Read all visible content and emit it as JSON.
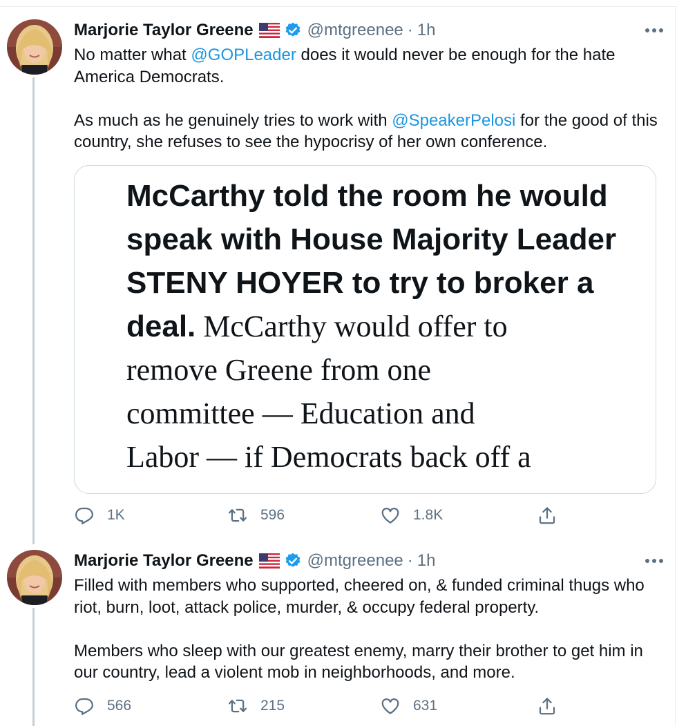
{
  "tweets": [
    {
      "author": {
        "name": "Marjorie Taylor Greene",
        "flag_icon": "us-flag-icon",
        "verified_icon": "verified-badge-icon",
        "handle": "@mtgreenee",
        "separator": "·",
        "time": "1h"
      },
      "text": {
        "para1_a": "No matter what ",
        "para1_mention": "@GOPLeader",
        "para1_b": " does it would never be enough for the hate America Democrats.",
        "para2_a": "As much as he genuinely tries to work with ",
        "para2_mention": "@SpeakerPelosi",
        "para2_b": " for the good of this country, she refuses to see the hypocrisy of her own conference."
      },
      "card": {
        "line1": "McCarthy told the room he would",
        "line2": "speak with House Majority Leader",
        "line3": "STENY HOYER to try to broker a",
        "line4_bold": "deal.",
        "line4_rest": " McCarthy would offer to",
        "line5": "remove Greene from one",
        "line6": "committee — Education and",
        "line7": "Labor — if Democrats back off a"
      },
      "actions": {
        "reply": "1K",
        "retweet": "596",
        "like": "1.8K"
      }
    },
    {
      "author": {
        "name": "Marjorie Taylor Greene",
        "flag_icon": "us-flag-icon",
        "verified_icon": "verified-badge-icon",
        "handle": "@mtgreenee",
        "separator": "·",
        "time": "1h"
      },
      "text": {
        "para1": "Filled with members who supported, cheered on, & funded criminal thugs who riot, burn, loot, attack police, murder, & occupy federal property.",
        "para2": "Members who sleep with our greatest enemy, marry their brother to get him in our country, lead a violent mob in neighborhoods, and more."
      },
      "actions": {
        "reply": "566",
        "retweet": "215",
        "like": "631"
      }
    }
  ],
  "colors": {
    "link": "#1b95e0",
    "secondary": "#5b7083",
    "verified": "#1d9bf0",
    "thread_line": "#c4cfd6"
  }
}
